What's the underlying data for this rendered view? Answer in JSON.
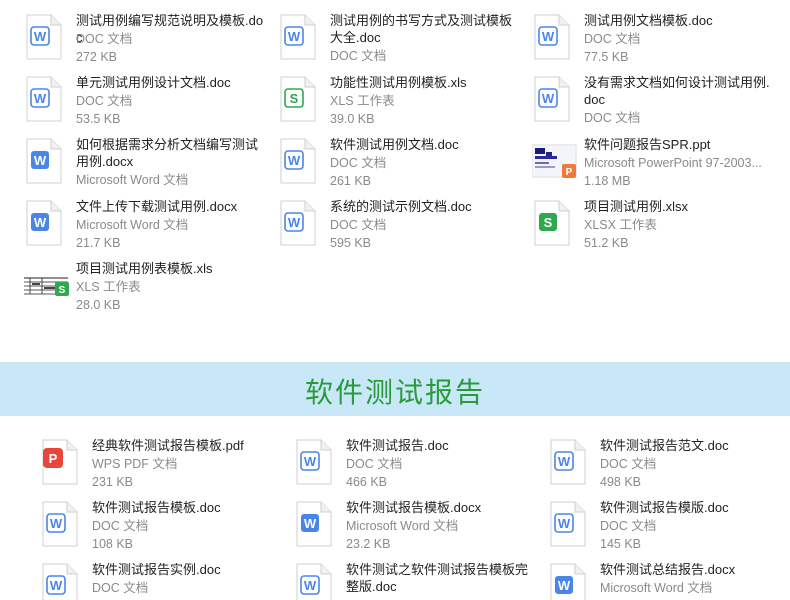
{
  "section_title": "软件测试报告",
  "top_files": [
    {
      "name": "测试用例编写规范说明及模板.doc",
      "type": "DOC 文档",
      "size": "272 KB",
      "icon": "word-doc-icon"
    },
    {
      "name": "测试用例的书写方式及测试模板大全.doc",
      "type": "DOC 文档",
      "size": "",
      "icon": "word-doc-icon"
    },
    {
      "name": "测试用例文档模板.doc",
      "type": "DOC 文档",
      "size": "77.5 KB",
      "icon": "word-doc-icon"
    },
    {
      "name": "单元测试用例设计文档.doc",
      "type": "DOC 文档",
      "size": "53.5 KB",
      "icon": "word-doc-icon"
    },
    {
      "name": "功能性测试用例模板.xls",
      "type": "XLS 工作表",
      "size": "39.0 KB",
      "icon": "excel-sheet-icon"
    },
    {
      "name": "没有需求文档如何设计测试用例.doc",
      "type": "DOC 文档",
      "size": "",
      "icon": "word-doc-icon"
    },
    {
      "name": "如何根据需求分析文档编写测试用例.docx",
      "type": "Microsoft Word 文档",
      "size": "",
      "icon": "word-docx-icon"
    },
    {
      "name": "软件测试用例文档.doc",
      "type": "DOC 文档",
      "size": "261 KB",
      "icon": "word-doc-icon"
    },
    {
      "name": "软件问题报告SPR.ppt",
      "type": "Microsoft PowerPoint 97-2003...",
      "size": "1.18 MB",
      "icon": "ppt-thumbnail-icon"
    },
    {
      "name": "文件上传下载测试用例.docx",
      "type": "Microsoft Word 文档",
      "size": "21.7 KB",
      "icon": "word-docx-icon"
    },
    {
      "name": "系统的测试示例文档.doc",
      "type": "DOC 文档",
      "size": "595 KB",
      "icon": "word-doc-icon"
    },
    {
      "name": "项目测试用例.xlsx",
      "type": "XLSX 工作表",
      "size": "51.2 KB",
      "icon": "excel-xlsx-icon"
    },
    {
      "name": "项目测试用例表模板.xls",
      "type": "XLS 工作表",
      "size": "28.0 KB",
      "icon": "xls-thumbnail-icon"
    }
  ],
  "bottom_files": [
    {
      "name": "经典软件测试报告模板.pdf",
      "type": "WPS PDF 文档",
      "size": "231 KB",
      "icon": "pdf-icon"
    },
    {
      "name": "软件测试报告.doc",
      "type": "DOC 文档",
      "size": "466 KB",
      "icon": "word-doc-icon"
    },
    {
      "name": "软件测试报告范文.doc",
      "type": "DOC 文档",
      "size": "498 KB",
      "icon": "word-doc-icon"
    },
    {
      "name": "软件测试报告模板.doc",
      "type": "DOC 文档",
      "size": "108 KB",
      "icon": "word-doc-icon"
    },
    {
      "name": "软件测试报告模板.docx",
      "type": "Microsoft Word 文档",
      "size": "23.2 KB",
      "icon": "word-docx-icon"
    },
    {
      "name": "软件测试报告模版.doc",
      "type": "DOC 文档",
      "size": "145 KB",
      "icon": "word-doc-icon"
    },
    {
      "name": "软件测试报告实例.doc",
      "type": "",
      "size": "",
      "icon": "word-doc-icon"
    },
    {
      "name": "软件测试之软件测试报告模板完整版.doc",
      "type": "",
      "size": "",
      "icon": "word-doc-icon"
    },
    {
      "name": "软件测试总结报告.docx",
      "type": "Microsoft Word 文档",
      "size": "",
      "icon": "word-docx-icon"
    }
  ]
}
